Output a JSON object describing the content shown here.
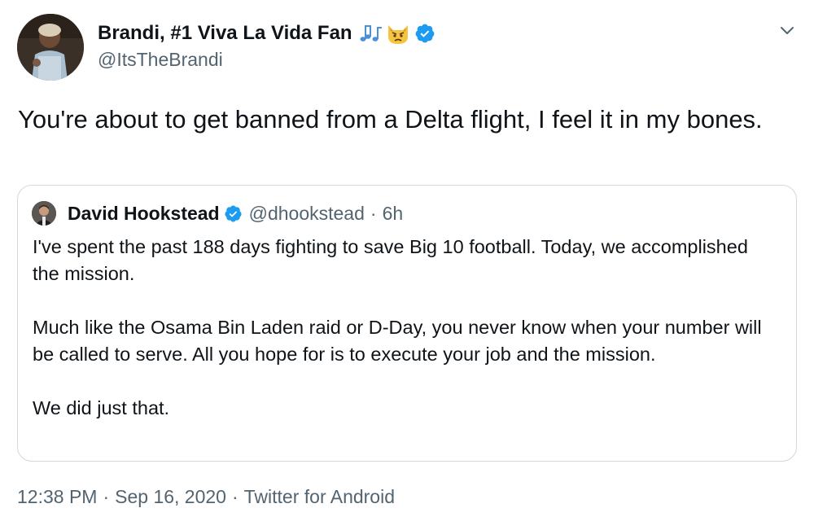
{
  "author": {
    "display_name": "Brandi, #1 Viva La Vida Fan",
    "handle": "@ItsTheBrandi",
    "emoji_icons": [
      "music-notes-icon",
      "pouting-cat-icon"
    ],
    "verified": true
  },
  "tweet": {
    "text": "You're about to get banned from a Delta flight, I feel it in my bones."
  },
  "quoted_tweet": {
    "display_name": "David Hookstead",
    "handle": "@dhookstead",
    "separator": "·",
    "time_ago": "6h",
    "verified": true,
    "paragraphs": [
      "I've spent the past 188 days fighting to save Big 10 football. Today, we accomplished the mission.",
      "Much like the Osama Bin Laden raid or D-Day, you never know when your number will be called to serve. All you hope for is to execute your job and the mission.",
      "We did just that."
    ]
  },
  "meta": {
    "time": "12:38 PM",
    "separator": "·",
    "date": "Sep 16, 2020",
    "source": "Twitter for Android"
  },
  "colors": {
    "text": "#0f1419",
    "secondary": "#536471",
    "verified": "#1d9bf0",
    "border": "#cfd9de"
  }
}
